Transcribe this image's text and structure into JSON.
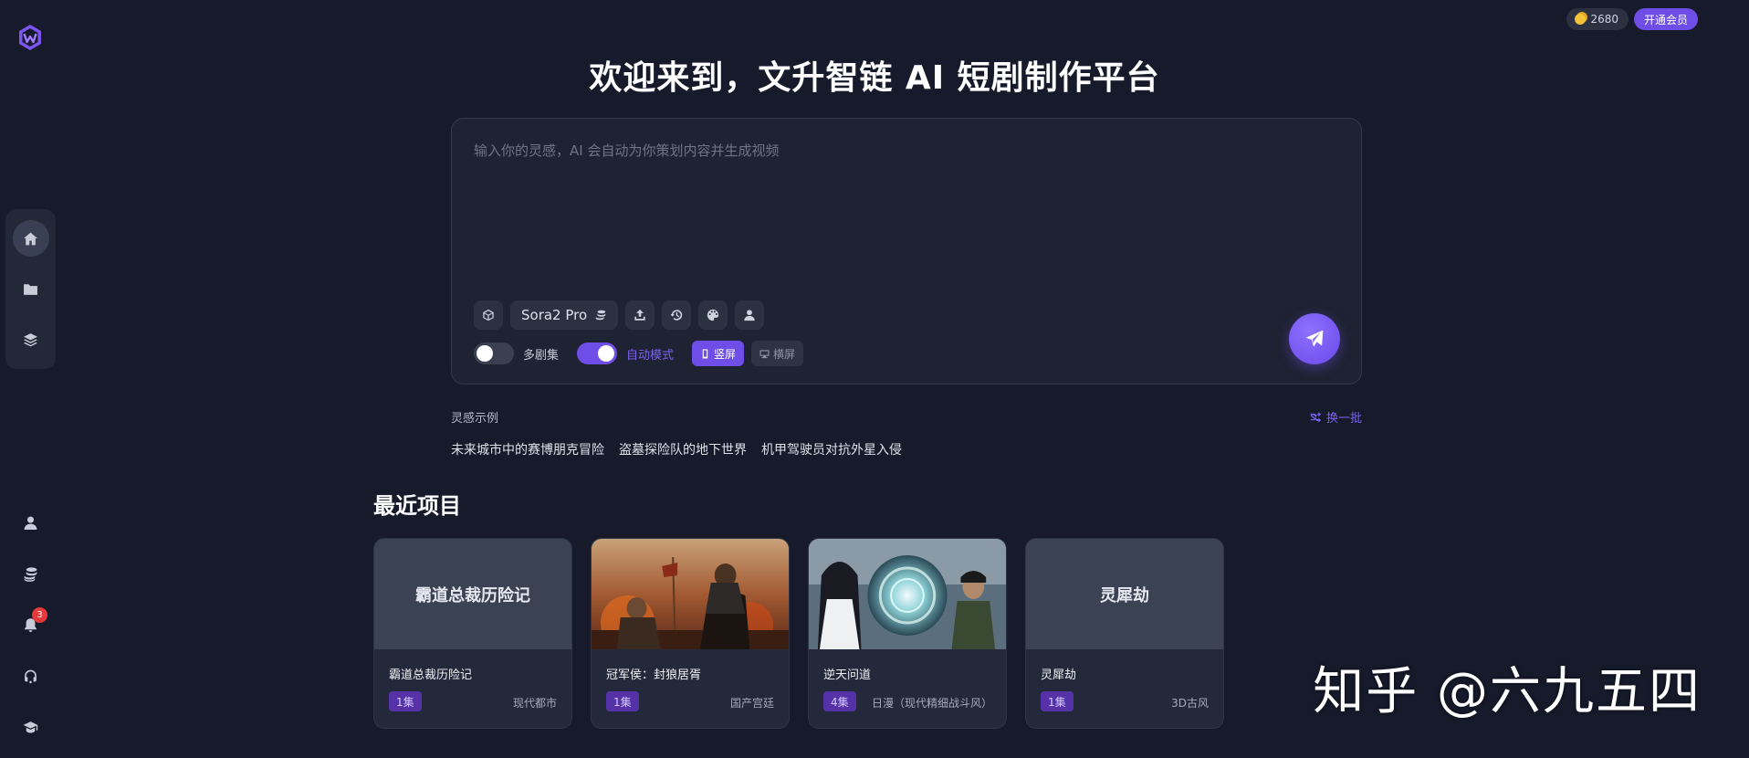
{
  "header": {
    "coins": "2680",
    "vip_label": "开通会员"
  },
  "hero": {
    "title": "欢迎来到，文升智链 AI 短剧制作平台"
  },
  "prompt": {
    "placeholder": "输入你的灵感，AI 会自动为你策划内容并生成视频",
    "value": "",
    "model_label": "Sora2 Pro",
    "multi_episode_label": "多剧集",
    "multi_episode_on": false,
    "auto_mode_label": "自动模式",
    "auto_mode_on": true,
    "portrait_label": "竖屏",
    "landscape_label": "横屏",
    "selected_orientation": "竖屏"
  },
  "inspiration": {
    "label": "灵感示例",
    "refresh_label": "换一批",
    "items": [
      "未来城市中的赛博朋克冒险",
      "盗墓探险队的地下世界",
      "机甲驾驶员对抗外星入侵"
    ]
  },
  "recent": {
    "title": "最近项目",
    "projects": [
      {
        "cover_text": "霸道总裁历险记",
        "name": "霸道总裁历险记",
        "episodes": "1集",
        "genre": "现代都市"
      },
      {
        "cover_text": "",
        "name": "冠军侯：封狼居胥",
        "episodes": "1集",
        "genre": "国产宫廷"
      },
      {
        "cover_text": "",
        "name": "逆天问道",
        "episodes": "4集",
        "genre": "日漫（现代精细战斗风）"
      },
      {
        "cover_text": "灵犀劫",
        "name": "灵犀劫",
        "episodes": "1集",
        "genre": "3D古风"
      }
    ]
  },
  "sidebar": {
    "notification_count": "3",
    "icons": [
      "home-icon",
      "folder-icon",
      "layers-icon",
      "user-icon",
      "coins-icon",
      "bell-icon",
      "headset-icon",
      "graduation-cap-icon"
    ]
  },
  "colors": {
    "accent": "#6e4ee6",
    "background": "#161a2b",
    "panel": "#1e2232"
  },
  "watermark": "知乎 @六九五四"
}
